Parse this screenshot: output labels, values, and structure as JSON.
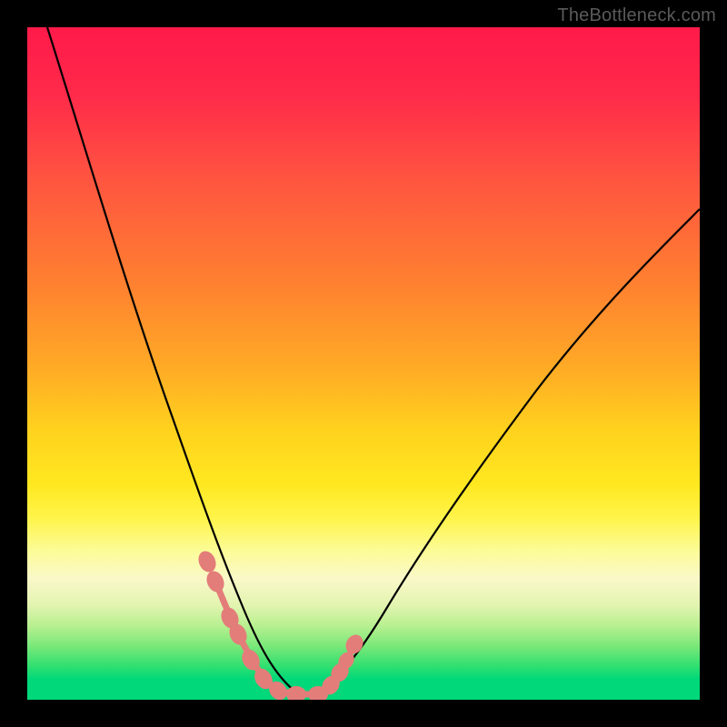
{
  "watermark": "TheBottleneck.com",
  "chart_data": {
    "type": "line",
    "title": "",
    "xlabel": "",
    "ylabel": "",
    "xlim": [
      0,
      100
    ],
    "ylim": [
      0,
      100
    ],
    "grid": false,
    "legend": false,
    "left_curve": {
      "x": [
        3,
        5,
        8,
        11,
        14,
        17,
        20,
        22,
        24,
        26,
        27.5,
        29,
        30.5,
        32,
        34,
        36,
        38,
        40,
        42
      ],
      "y": [
        100,
        90,
        78,
        66,
        55,
        45,
        36,
        30,
        25,
        21,
        18,
        15,
        12,
        9.5,
        6.5,
        4,
        2,
        1,
        0.3
      ]
    },
    "right_curve": {
      "x": [
        42,
        44,
        46,
        48,
        50,
        53,
        56,
        60,
        64,
        68,
        72,
        76,
        80,
        85,
        90,
        95,
        100
      ],
      "y": [
        0.3,
        1,
        2.5,
        4.5,
        7,
        10,
        14,
        19,
        25,
        31,
        37,
        43,
        49,
        56,
        62,
        68,
        74
      ]
    },
    "beads_left": {
      "x": [
        26.5,
        27.8,
        30.2,
        31.5,
        33.2,
        35.0,
        36.8,
        38.4
      ],
      "y": [
        20.5,
        17.5,
        11.5,
        9.0,
        5.5,
        3.2,
        1.6,
        0.8
      ]
    },
    "beads_right": {
      "x": [
        43.2,
        44.6,
        46.4,
        48.2
      ],
      "y": [
        0.9,
        2.0,
        4.0,
        6.5
      ]
    },
    "beads_bottom_x": [
      38.4,
      40.0,
      41.6,
      43.2
    ],
    "background_gradient": {
      "stops": [
        {
          "pos": 0,
          "color": "#ff1a4a"
        },
        {
          "pos": 0.5,
          "color": "#ffa826"
        },
        {
          "pos": 0.78,
          "color": "#fcfc9a"
        },
        {
          "pos": 1.0,
          "color": "#00d87a"
        }
      ]
    }
  }
}
